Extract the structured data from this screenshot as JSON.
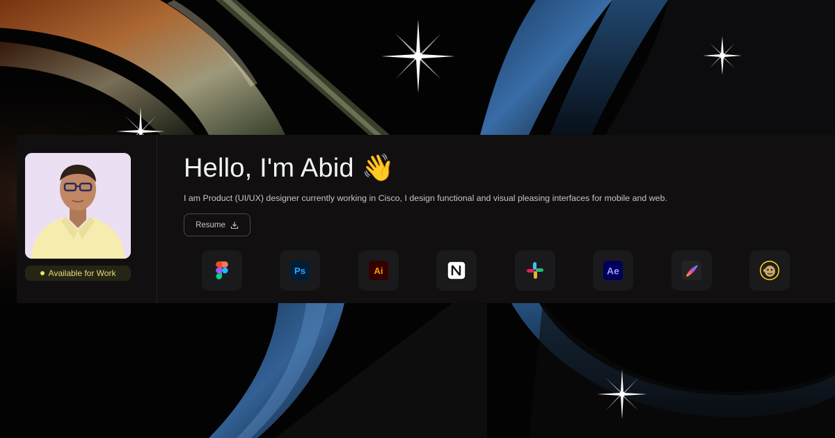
{
  "profile": {
    "avatar_alt": "Abid",
    "badge_label": "Available for Work"
  },
  "hero": {
    "title": "Hello, I'm Abid 👋",
    "bio": "I am Product (UI/UX) designer currently working in Cisco, I design functional and visual pleasing interfaces for mobile and web.",
    "resume_label": "Resume"
  },
  "tools": [
    {
      "name": "Figma",
      "icon": "figma-icon"
    },
    {
      "name": "Ps",
      "icon": "photoshop-icon"
    },
    {
      "name": "Ai",
      "icon": "illustrator-icon"
    },
    {
      "name": "Notion",
      "icon": "notion-icon"
    },
    {
      "name": "Slack",
      "icon": "slack-icon"
    },
    {
      "name": "Ae",
      "icon": "after-effects-icon"
    },
    {
      "name": "Procreate",
      "icon": "procreate-icon"
    },
    {
      "name": "Mailchimp",
      "icon": "mailchimp-icon"
    }
  ],
  "colors": {
    "card_bg": "#110f0f",
    "badge_bg": "#252515",
    "badge_text": "#ecd87a",
    "photoshop": "#31a8ff",
    "illustrator": "#ff9a00",
    "after_effects": "#9999ff"
  }
}
